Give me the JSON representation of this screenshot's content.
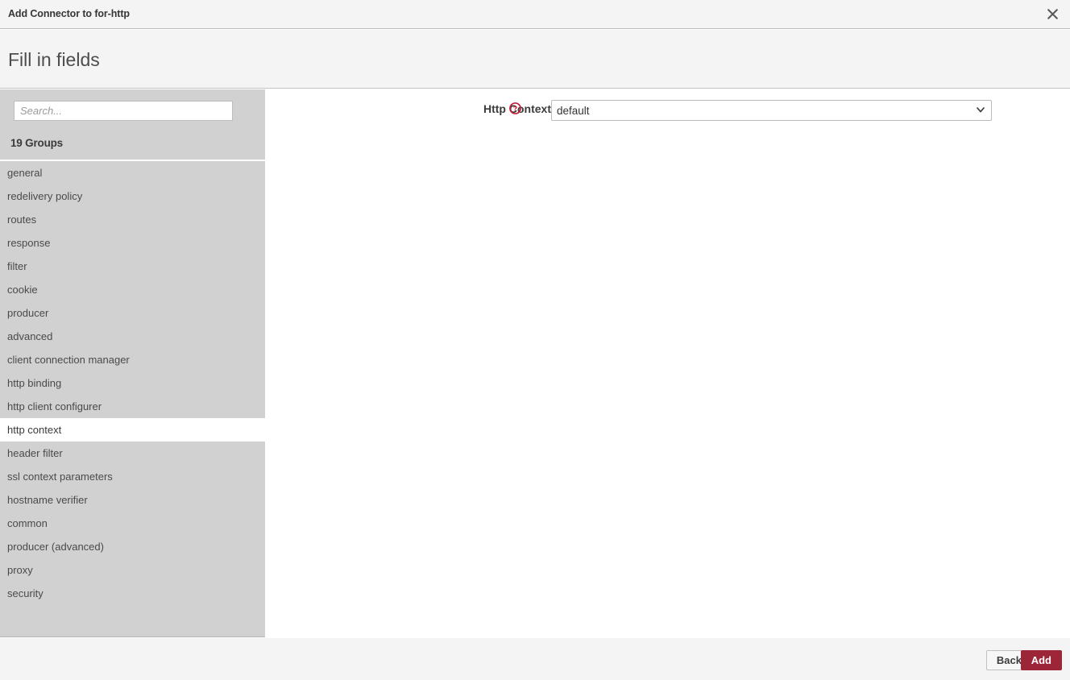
{
  "window": {
    "title": "Add Connector to for-http",
    "close_icon": "close-icon"
  },
  "header": {
    "title": "Fill in fields"
  },
  "sidebar": {
    "search": {
      "placeholder": "Search...",
      "value": ""
    },
    "groups_count_label": "19 Groups",
    "groups": [
      {
        "label": "general",
        "selected": false
      },
      {
        "label": "redelivery policy",
        "selected": false
      },
      {
        "label": "routes",
        "selected": false
      },
      {
        "label": "response",
        "selected": false
      },
      {
        "label": "filter",
        "selected": false
      },
      {
        "label": "cookie",
        "selected": false
      },
      {
        "label": "producer",
        "selected": false
      },
      {
        "label": "advanced",
        "selected": false
      },
      {
        "label": "client connection manager",
        "selected": false
      },
      {
        "label": "http binding",
        "selected": false
      },
      {
        "label": "http client configurer",
        "selected": false
      },
      {
        "label": "http context",
        "selected": true
      },
      {
        "label": "header filter",
        "selected": false
      },
      {
        "label": "ssl context parameters",
        "selected": false
      },
      {
        "label": "hostname verifier",
        "selected": false
      },
      {
        "label": "common",
        "selected": false
      },
      {
        "label": "producer (advanced)",
        "selected": false
      },
      {
        "label": "proxy",
        "selected": false
      },
      {
        "label": "security",
        "selected": false
      }
    ]
  },
  "form": {
    "fields": [
      {
        "label": "Http Context",
        "help_icon": "help-circle-icon",
        "control": "select",
        "value": "default",
        "options": [
          "default"
        ]
      }
    ]
  },
  "footer": {
    "back_label": "Back",
    "add_label": "Add"
  },
  "colors": {
    "accent": "#9c2537",
    "help_icon": "#c41e3a",
    "sidebar_bg": "#d1d1d1",
    "header_bg": "#f4f4f4"
  }
}
